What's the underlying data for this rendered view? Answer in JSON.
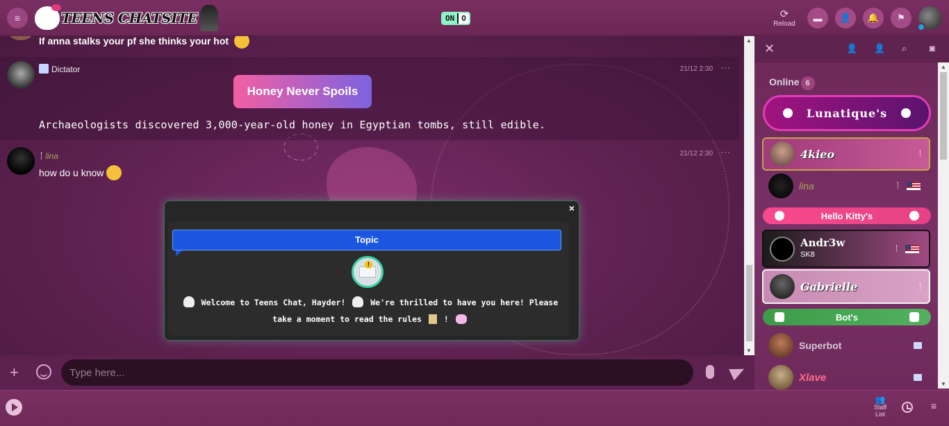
{
  "header": {
    "logo_text": "TEENS CHATSITE",
    "toggle_on": "ON",
    "toggle_off": "O",
    "reload_label": "Reload"
  },
  "messages": {
    "top_partial_text": "If anna stalks your pf she thinks your hot",
    "dictator": {
      "username": "Dictator",
      "time": "21/12 2:30",
      "title_pill": "Honey Never Spoils",
      "fact": "Archaeologists discovered 3,000-year-old honey in Egyptian tombs, still edible."
    },
    "lina": {
      "username": "lina",
      "time": "21/12 2:30",
      "text": "how do u know"
    },
    "more": "···"
  },
  "topic_modal": {
    "header": "Topic",
    "text_part1": "Welcome to Teens Chat, Hayder!",
    "text_part2": "We're thrilled to have you here! Please take a moment to read the rules",
    "text_part3": "!",
    "close": "×"
  },
  "input": {
    "placeholder": "Type here..."
  },
  "bottom": {
    "staff_list_label": "Staff List"
  },
  "sidebar": {
    "online_label": "Online",
    "online_count": "6",
    "ranks": {
      "lunatique": "Lunatique's",
      "hello_kitty": "Hello Kitty's",
      "bots": "Bot's"
    },
    "users": [
      {
        "name": "4kieo"
      },
      {
        "name": "lina"
      },
      {
        "name": "Andr3w",
        "sub": "SK8"
      },
      {
        "name": "Gabrielle"
      },
      {
        "name": "Superbot"
      },
      {
        "name": "Xlave"
      }
    ]
  }
}
